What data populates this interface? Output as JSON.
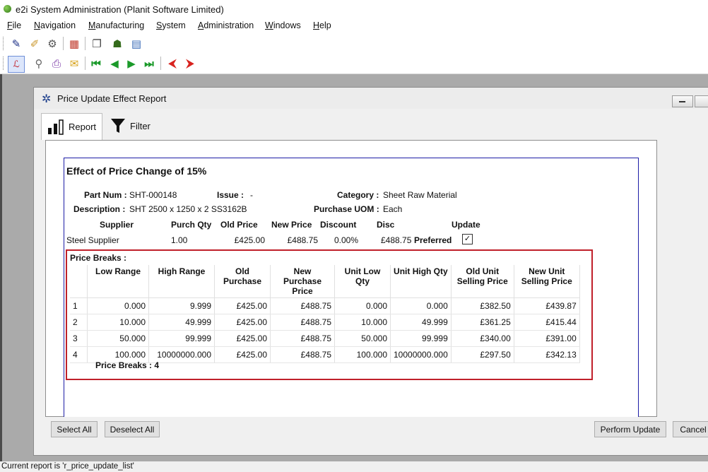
{
  "app": {
    "title": "e2i System Administration (Planit Software Limited)"
  },
  "menu": [
    {
      "key": "F",
      "rest": "ile"
    },
    {
      "key": "N",
      "rest": "avigation"
    },
    {
      "key": "M",
      "rest": "anufacturing"
    },
    {
      "key": "S",
      "rest": "ystem"
    },
    {
      "key": "A",
      "rest": "dministration"
    },
    {
      "key": "W",
      "rest": "indows"
    },
    {
      "key": "H",
      "rest": "elp"
    }
  ],
  "window": {
    "title": "Price Update Effect Report"
  },
  "tabs": {
    "report": "Report",
    "filter": "Filter"
  },
  "report": {
    "heading": "Effect of Price Change of 15%",
    "part_num_label": "Part Num :",
    "part_num": "SHT-000148",
    "issue_label": "Issue :",
    "issue": "-",
    "category_label": "Category :",
    "category": "Sheet Raw Material",
    "description_label": "Description :",
    "description": "SHT 2500 x 1250 x 2 SS3162B",
    "uom_label": "Purchase UOM :",
    "uom": "Each",
    "supplier_headers": {
      "supplier": "Supplier",
      "purch_qty": "Purch Qty",
      "old_price": "Old Price",
      "new_price": "New Price",
      "discount": "Discount",
      "disc": "Disc",
      "update": "Update"
    },
    "supplier_row": {
      "supplier": "Steel Supplier",
      "purch_qty": "1.00",
      "old_price": "£425.00",
      "new_price": "£488.75",
      "discount": "0.00%",
      "disc": "£488.75",
      "preferred": "Preferred"
    },
    "price_breaks_label": "Price Breaks :",
    "pb_headers": [
      "Low Range",
      "High Range",
      "Old Purchase",
      "New Purchase Price",
      "Unit Low Qty",
      "Unit High Qty",
      "Old Unit Selling Price",
      "New Unit Selling Price"
    ],
    "pb_rows": [
      [
        "1",
        "0.000",
        "9.999",
        "£425.00",
        "£488.75",
        "0.000",
        "0.000",
        "£382.50",
        "£439.87"
      ],
      [
        "2",
        "10.000",
        "49.999",
        "£425.00",
        "£488.75",
        "10.000",
        "49.999",
        "£361.25",
        "£415.44"
      ],
      [
        "3",
        "50.000",
        "99.999",
        "£425.00",
        "£488.75",
        "50.000",
        "99.999",
        "£340.00",
        "£391.00"
      ],
      [
        "4",
        "100.000",
        "10000000.000",
        "£425.00",
        "£488.75",
        "100.000",
        "10000000.000",
        "£297.50",
        "£342.13"
      ]
    ],
    "pb_count_label": "Price Breaks : 4"
  },
  "buttons": {
    "select_all": "Select All",
    "deselect_all": "Deselect All",
    "perform_update": "Perform Update",
    "cancel": "Cancel"
  },
  "status": "Current report is 'r_price_update_list'"
}
